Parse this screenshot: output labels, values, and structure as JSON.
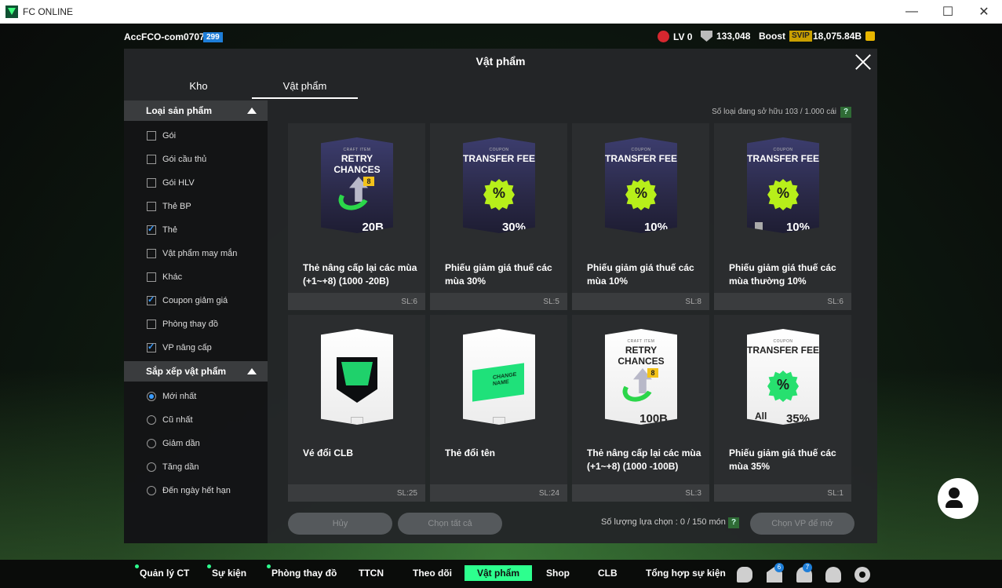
{
  "window": {
    "title": "FC ONLINE",
    "minimize": "—",
    "maximize": "☐",
    "close": "✕"
  },
  "topbar": {
    "username": "AccFCO-com0707c",
    "user_level": "299",
    "rank": "LV 0",
    "points": "133,048",
    "boost_label": "Boost",
    "svip": "SVIP",
    "coins": "18,075.84B"
  },
  "modal": {
    "title": "Vật phẩm",
    "tabs": [
      "Kho",
      "Vật phẩm"
    ],
    "active_tab": 1
  },
  "sidebar": {
    "product_type_header": "Loại sản phẩm",
    "product_types": [
      {
        "label": "Gói",
        "checked": false
      },
      {
        "label": "Gói cầu thủ",
        "checked": false
      },
      {
        "label": "Gói HLV",
        "checked": false
      },
      {
        "label": "Thẻ BP",
        "checked": false
      },
      {
        "label": "Thẻ",
        "checked": true
      },
      {
        "label": "Vật phẩm may mắn",
        "checked": false
      },
      {
        "label": "Khác",
        "checked": false
      },
      {
        "label": "Coupon giảm giá",
        "checked": true
      },
      {
        "label": "Phòng thay đồ",
        "checked": false
      },
      {
        "label": "VP nâng cấp",
        "checked": true
      }
    ],
    "sort_header": "Sắp xếp vật phẩm",
    "sort_options": [
      {
        "label": "Mới nhất",
        "selected": true
      },
      {
        "label": "Cũ nhất",
        "selected": false
      },
      {
        "label": "Giảm dần",
        "selected": false
      },
      {
        "label": "Tăng dần",
        "selected": false
      },
      {
        "label": "Đến ngày hết hạn",
        "selected": false
      }
    ]
  },
  "owned_info": "Số loại đang sở hữu   103 / 1.000 cái",
  "help": "?",
  "items": [
    {
      "name": "Thẻ nâng cấp lại các mùa (+1~+8) (1000 -20B)",
      "qty": "SL:6",
      "pack_small": "CRAFT ITEM",
      "pack_big": "RETRY CHANCES",
      "pack_value": "20B",
      "style": "dark",
      "art": "arrow"
    },
    {
      "name": "Phiếu giảm giá thuế các mùa 30%",
      "qty": "SL:5",
      "pack_small": "COUPON",
      "pack_big": "TRANSFER FEE",
      "pack_value": "30%",
      "style": "dark",
      "art": "pct"
    },
    {
      "name": "Phiếu giảm giá thuế các mùa 10%",
      "qty": "SL:8",
      "pack_small": "COUPON",
      "pack_big": "TRANSFER FEE",
      "pack_value": "10%",
      "style": "dark",
      "art": "pct"
    },
    {
      "name": "Phiếu giảm giá thuế các mùa thường 10%",
      "qty": "SL:6",
      "pack_small": "COUPON",
      "pack_big": "TRANSFER FEE",
      "pack_value": "10%",
      "style": "dark",
      "art": "pct-banned"
    },
    {
      "name": "Vé đổi CLB",
      "qty": "SL:25",
      "pack_small": "",
      "pack_big": "",
      "pack_value": "",
      "style": "light",
      "art": "shield"
    },
    {
      "name": "Thẻ đổi tên",
      "qty": "SL:24",
      "pack_small": "",
      "pack_big": "",
      "pack_value": "",
      "style": "light",
      "art": "ticket",
      "ticket_text": "CHANGE NAME"
    },
    {
      "name": "Thẻ nâng cấp lại các mùa (+1~+8) (1000 -100B)",
      "qty": "SL:3",
      "pack_small": "CRAFT ITEM",
      "pack_big": "RETRY CHANCES",
      "pack_value": "100B",
      "style": "light",
      "art": "arrow"
    },
    {
      "name": "Phiếu giảm giá thuế các mùa 35%",
      "qty": "SL:1",
      "pack_small": "COUPON",
      "pack_big": "TRANSFER FEE",
      "pack_value": "35%",
      "style": "light",
      "art": "pct-all",
      "class_label": "All"
    }
  ],
  "actions": {
    "cancel": "Hủy",
    "select_all": "Chọn tất cả",
    "selection_info": "Số lượng lựa chọn : 0 / 150 món",
    "open": "Chọn VP để mở"
  },
  "nav": [
    {
      "label": "Quản lý CT",
      "dot": true
    },
    {
      "label": "Sự kiện",
      "dot": true
    },
    {
      "label": "Phòng thay đồ",
      "dot": true
    },
    {
      "label": "TTCN",
      "dot": false
    },
    {
      "label": "Theo dõi",
      "dot": false
    },
    {
      "label": "Vật phẩm",
      "dot": false,
      "active": true
    },
    {
      "label": "Shop",
      "dot": false
    },
    {
      "label": "CLB",
      "dot": false
    },
    {
      "label": "Tổng hợp sự kiện",
      "dot": false
    }
  ],
  "nav_badges": {
    "gift": "6",
    "bell": "7"
  },
  "colors": {
    "accent": "#2dff8e",
    "check": "#3a9cff",
    "level_badge": "#1e7ed8"
  }
}
